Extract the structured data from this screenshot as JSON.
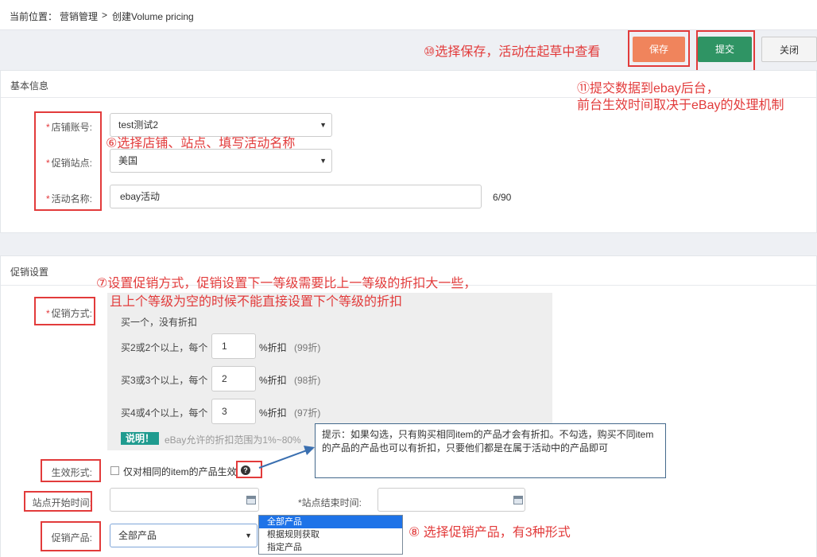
{
  "breadcrumb": {
    "prefix": "当前位置：",
    "crumb1": "营销管理",
    "separator": ">",
    "crumb2": "创建Volume pricing"
  },
  "toolbar": {
    "save": "保存",
    "submit": "提交",
    "close": "关闭"
  },
  "basic": {
    "title": "基本信息",
    "store_label": "店铺账号:",
    "store_value": "test测试2",
    "site_label": "促销站点:",
    "site_value": "美国",
    "name_label": "活动名称:",
    "name_value": "ebay活动",
    "name_counter": "6/90"
  },
  "promo": {
    "title": "促销设置",
    "method_label": "促销方式:",
    "tier1": "买一个，没有折扣",
    "tiers": [
      {
        "prefix": "买2或2个以上，每个",
        "value": "1",
        "suffix": "%折扣",
        "hint": "(99折)"
      },
      {
        "prefix": "买3或3个以上，每个",
        "value": "2",
        "suffix": "%折扣",
        "hint": "(98折)"
      },
      {
        "prefix": "买4或4个以上，每个",
        "value": "3",
        "suffix": "%折扣",
        "hint": "(97折)"
      }
    ],
    "note_badge": "说明！",
    "note_text": "eBay允许的折扣范围为1%~80%",
    "effect_label": "生效形式:",
    "effect_checkbox": "仅对相同的item的产品生效",
    "start_label": "站点开始时间:",
    "end_label": "*站点结束时间:",
    "product_label": "促销产品:",
    "product_value": "全部产品",
    "product_options": [
      "全部产品",
      "根据规则获取",
      "指定产品"
    ]
  },
  "tooltip": {
    "text": "提示：如果勾选，只有购买相同item的产品才会有折扣。不勾选，购买不同item的产品的产品也可以有折扣，只要他们都是在属于活动中的产品即可"
  },
  "annotations": {
    "a10": "⑩选择保存，活动在起草中查看",
    "a11_line1": "⑪提交数据到ebay后台，",
    "a11_line2": "前台生效时间取决于eBay的处理机制",
    "a6": "⑥选择店铺、站点、填写活动名称",
    "a7_line1": "⑦设置促销方式，促销设置下一等级需要比上一等级的折扣大一些，",
    "a7_line2": "且上个等级为空的时候不能直接设置下个等级的折扣",
    "a8": "⑧ 选择促销产品，有3种形式"
  },
  "colors": {
    "save": "#f0845c",
    "submit": "#2f9464",
    "annotation": "#e23b3b",
    "badge": "#1f9b8f",
    "selected": "#1e73e8"
  }
}
